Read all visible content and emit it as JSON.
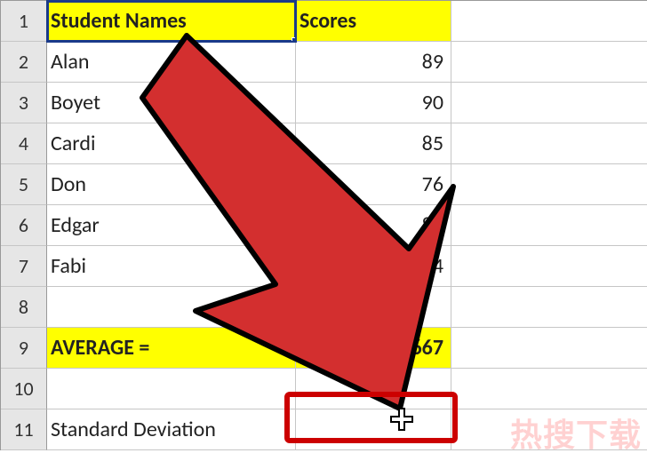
{
  "headers": {
    "colA": "Student Names",
    "colB": "Scores"
  },
  "rows": [
    {
      "num": "1"
    },
    {
      "num": "2",
      "a": "Alan",
      "b": "89"
    },
    {
      "num": "3",
      "a": "Boyet",
      "b": "90"
    },
    {
      "num": "4",
      "a": "Cardi",
      "b": "85"
    },
    {
      "num": "5",
      "a": "Don",
      "b": "76"
    },
    {
      "num": "6",
      "a": "Edgar",
      "b": "80"
    },
    {
      "num": "7",
      "a": "Fabi",
      "b": "94"
    },
    {
      "num": "8",
      "a": "",
      "b": ""
    },
    {
      "num": "9",
      "a": "AVERAGE =",
      "b": "66667"
    },
    {
      "num": "10",
      "a": "",
      "b": ""
    },
    {
      "num": "11",
      "a": "Standard Deviation",
      "b": ""
    }
  ],
  "watermark": "热搜下载",
  "colors": {
    "highlight": "#ffff00",
    "arrow": "#d32f2f",
    "arrowStroke": "#000000",
    "selectBox": "#cc0000"
  },
  "chart_data": {
    "type": "table",
    "title": "Student Names / Scores",
    "columns": [
      "Student Names",
      "Scores"
    ],
    "rows": [
      [
        "Alan",
        89
      ],
      [
        "Boyet",
        90
      ],
      [
        "Cardi",
        85
      ],
      [
        "Don",
        76
      ],
      [
        "Edgar",
        80
      ],
      [
        "Fabi",
        94
      ]
    ],
    "summary": {
      "AVERAGE": "…66667",
      "Standard Deviation": null
    }
  }
}
